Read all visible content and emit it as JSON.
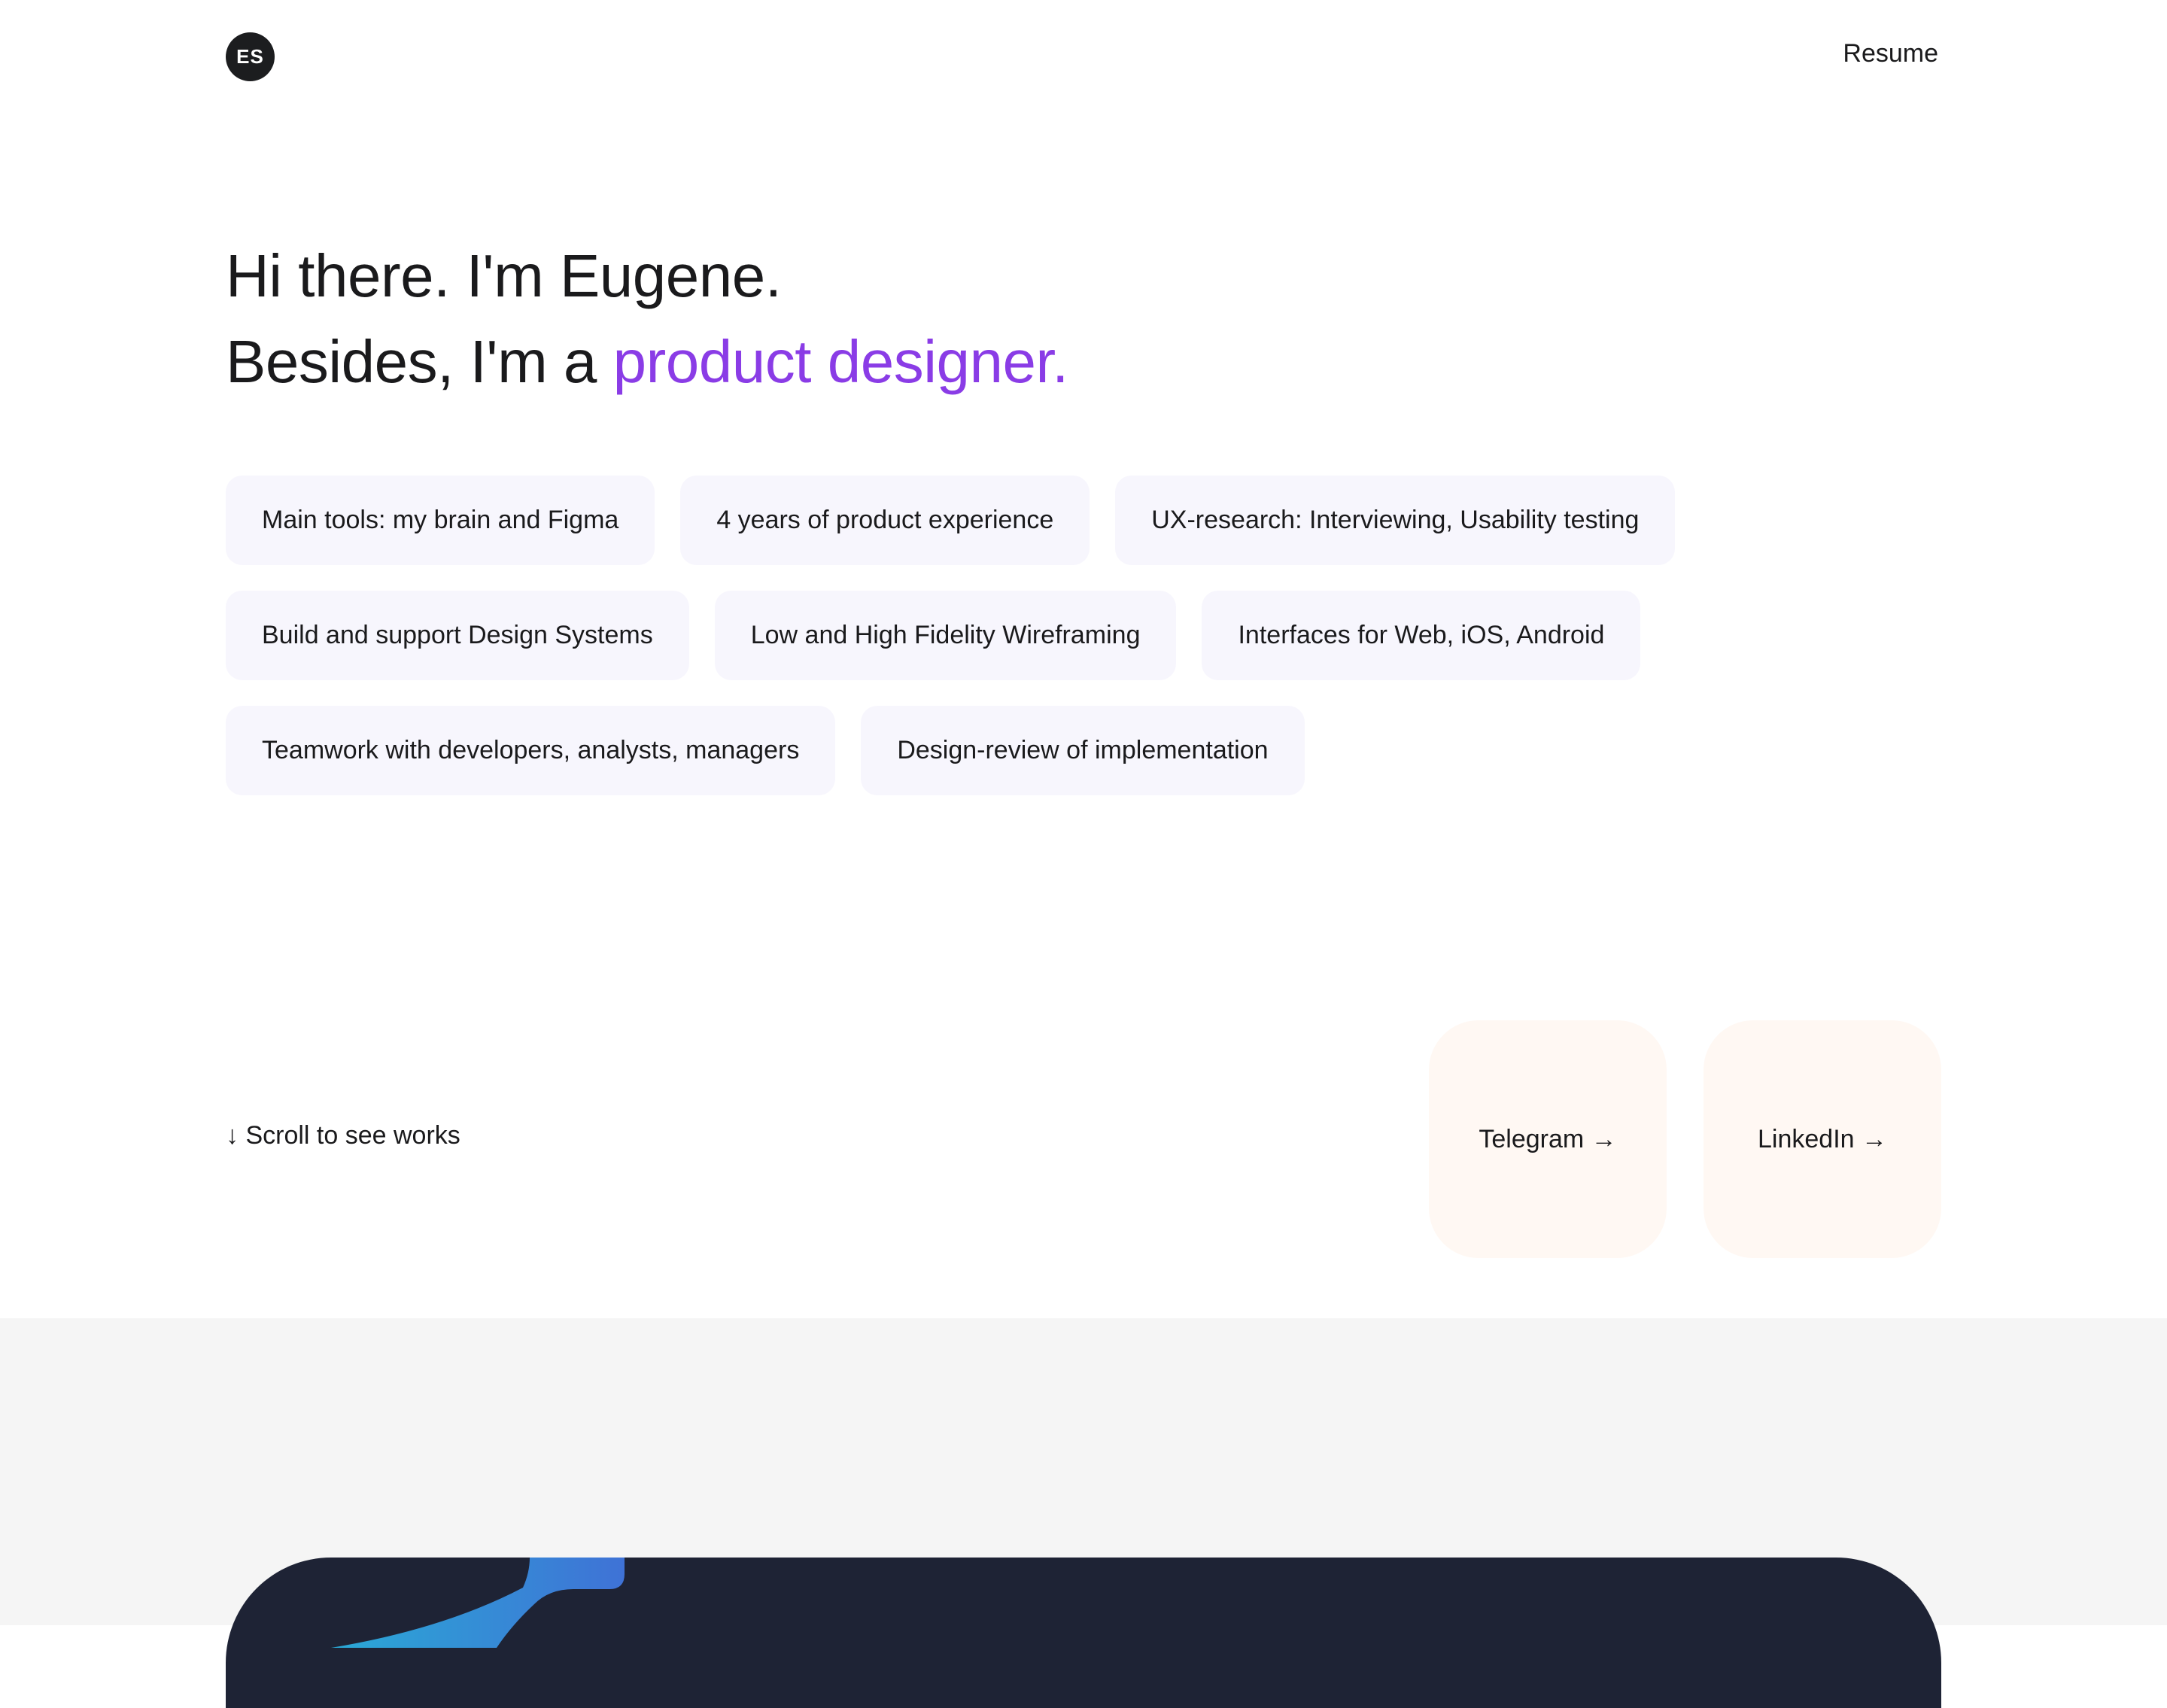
{
  "header": {
    "logo_initials": "ES",
    "resume_label": "Resume"
  },
  "hero": {
    "line1": "Hi there. I'm Eugene.",
    "line2_prefix": "Besides, I'm a ",
    "line2_accent": "product designer.",
    "accent_color": "#8a3ce6"
  },
  "skills": [
    [
      "Main tools: my brain and Figma",
      "4 years of product experience",
      "UX-research: Interviewing, Usability testing"
    ],
    [
      "Build and support Design Systems",
      "Low and High Fidelity Wireframing",
      "Interfaces for Web, iOS, Android"
    ],
    [
      "Teamwork with developers, analysts, managers",
      "Design-review of implementation"
    ]
  ],
  "scroll_hint": "↓ Scroll to see works",
  "social": {
    "telegram": "Telegram →",
    "linkedin": "LinkedIn →"
  },
  "colors": {
    "chip_bg": "#f7f6fd",
    "social_bg": "#fff8f3",
    "works_bg": "#f5f5f5",
    "card_bg": "#1e2335"
  }
}
